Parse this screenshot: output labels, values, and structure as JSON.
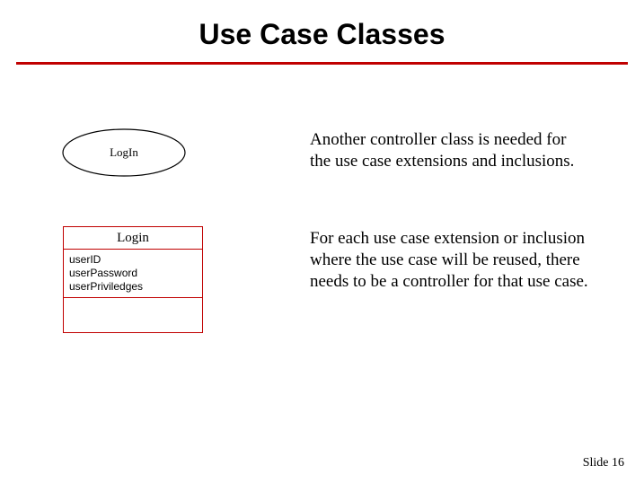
{
  "title": "Use Case Classes",
  "ellipse_label": "LogIn",
  "class_box": {
    "name": "Login",
    "attrs": [
      "userID",
      "userPassword",
      "userPriviledges"
    ]
  },
  "paragraph1": "Another controller class is needed for the use case extensions and inclusions.",
  "paragraph2": "For each use case extension or inclusion where the use case will be reused, there needs to be a controller for that use case.",
  "footer": "Slide 16"
}
